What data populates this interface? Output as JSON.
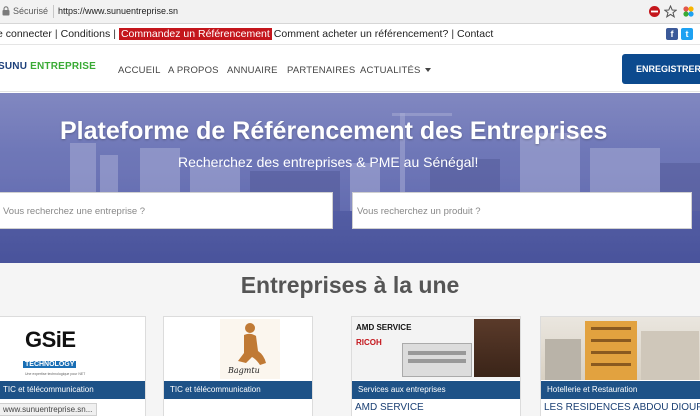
{
  "browser": {
    "secure_label": "Sécurisé",
    "url": "https://www.sunuentreprise.sn"
  },
  "topbar": {
    "links": [
      {
        "label": "e connecter"
      },
      {
        "label": "Conditions"
      },
      {
        "label": "Commandez un Référencement"
      },
      {
        "label": "Comment acheter un référencement?"
      },
      {
        "label": "Contact"
      }
    ],
    "fb": "f",
    "tw": "t"
  },
  "navbar": {
    "logo_part1": "SUNU",
    "logo_part2": "ENTREPRISE",
    "items": [
      {
        "label": "ACCUEIL"
      },
      {
        "label": "A PROPOS"
      },
      {
        "label": "ANNUAIRE"
      },
      {
        "label": "PARTENAIRES"
      },
      {
        "label": "ACTUALITÉS"
      }
    ],
    "register_label": "ENREGISTRER!"
  },
  "hero": {
    "title": "Plateforme de Référencement des Entreprises",
    "subtitle": "Recherchez des entreprises & PME au Sénégal!",
    "search_company_placeholder": "Vous recherchez une entreprise ?",
    "search_product_placeholder": "Vous recherchez un produit ?"
  },
  "featured": {
    "title": "Entreprises à la une",
    "cards": [
      {
        "category": "TIC et télécommunication",
        "logo_main": "GSiE",
        "logo_sub": "TECHNOLOGY",
        "logo_tagline": "Une expertise technologique pour NET"
      },
      {
        "category": "TIC et télécommunication",
        "logo_main": "Bagmtu"
      },
      {
        "category": "Services aux entreprises",
        "name": "AMD SERVICE",
        "brand_top": "AMD SERVICE",
        "brand_bottom": "RICOH"
      },
      {
        "category": "Hotellerie et Restauration",
        "name": "LES RESIDENCES ABDOU DIOUF"
      }
    ]
  },
  "status_bar": "www.sunuentreprise.sn...",
  "colors": {
    "brand_blue": "#0c4a8e",
    "card_band": "#1e5287",
    "highlight_red": "#c4161c",
    "logo_green": "#3aaa35"
  }
}
